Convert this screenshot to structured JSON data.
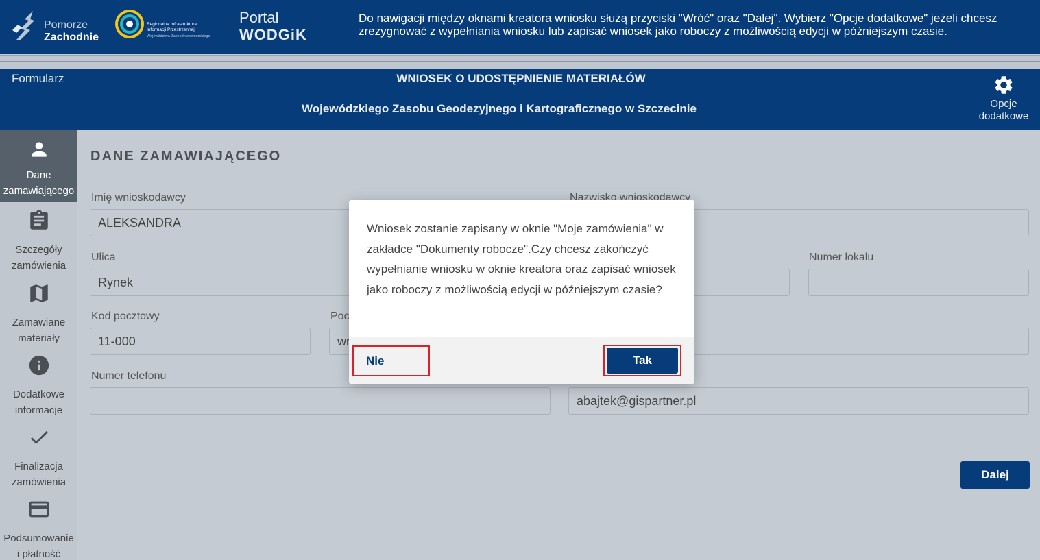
{
  "header": {
    "logo1_line1": "Pomorze",
    "logo1_line2": "Zachodnie",
    "logo2_line1": "Regionalna Infrastruktura Informacji Przestrzennej",
    "logo2_line2": "Województwa Zachodniopomorskiego",
    "portal_line1": "Portal",
    "portal_line2": "WODGiK",
    "info": "Do nawigacji między oknami kreatora wniosku służą przyciski \"Wróć\" oraz \"Dalej\". Wybierz \"Opcje dodatkowe\" jeżeli chcesz zrezygnować z wypełniania wniosku lub zapisać wniosek jako roboczy z możliwością edycji w późniejszym czasie."
  },
  "form_header": {
    "label": "Formularz",
    "title1": "WNIOSEK O UDOSTĘPNIENIE MATERIAŁÓW",
    "title2": "Wojewódzkiego Zasobu Geodezyjnego i Kartograficznego w Szczecinie",
    "options_line1": "Opcje",
    "options_line2": "dodatkowe"
  },
  "sidebar": {
    "items": [
      {
        "line1": "Dane",
        "line2": "zamawiającego",
        "icon": "person-icon"
      },
      {
        "line1": "Szczegóły",
        "line2": "zamówienia",
        "icon": "clipboard-icon"
      },
      {
        "line1": "Zamawiane",
        "line2": "materiały",
        "icon": "map-icon"
      },
      {
        "line1": "Dodatkowe",
        "line2": "informacje",
        "icon": "info-icon"
      },
      {
        "line1": "Finalizacja",
        "line2": "zamówienia",
        "icon": "check-icon"
      },
      {
        "line1": "Podsumowanie",
        "line2": "i płatność",
        "icon": "credit-card-icon"
      }
    ]
  },
  "main": {
    "section_title": "DANE ZAMAWIAJĄCEGO",
    "fields": {
      "first_name": {
        "label": "Imię wnioskodawcy",
        "value": "ALEKSANDRA"
      },
      "last_name": {
        "label": "Nazwisko wnioskodawcy",
        "value": ""
      },
      "street": {
        "label": "Ulica",
        "value": "Rynek"
      },
      "unit": {
        "label": "Numer lokalu",
        "value": ""
      },
      "postal": {
        "label": "Kod pocztowy",
        "value": "11-000"
      },
      "city": {
        "label": "Poc",
        "value": "wr"
      },
      "phone": {
        "label": "Numer telefonu",
        "value": ""
      },
      "email": {
        "label": "",
        "value": "abajtek@gispartner.pl"
      }
    },
    "next_label": "Dalej"
  },
  "modal": {
    "message": "Wniosek zostanie zapisany w oknie \"Moje zamówienia\" w zakładce \"Dokumenty robocze\".Czy chcesz zakończyć wypełnianie wniosku w oknie kreatora oraz zapisać wniosek jako roboczy z możliwością edycji w późniejszym czasie?",
    "no_label": "Nie",
    "yes_label": "Tak"
  },
  "colors": {
    "brand_navy": "#073c7a",
    "highlight_red": "#d9232b",
    "overlay_gray": "#c4cbd3"
  }
}
